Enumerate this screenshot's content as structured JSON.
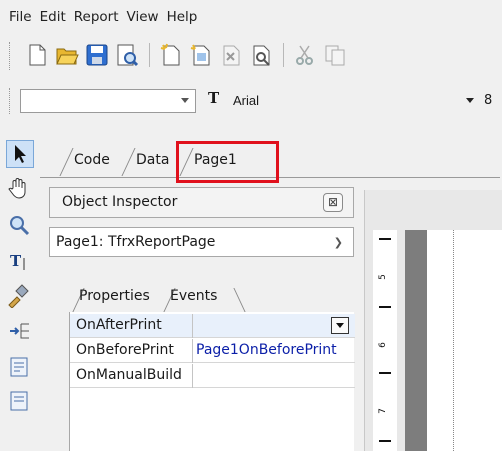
{
  "menu": [
    "File",
    "Edit",
    "Report",
    "View",
    "Help"
  ],
  "toolbar_icons": [
    "new-icon",
    "open-icon",
    "save-icon",
    "preview-icon",
    "new-page-icon",
    "new-dialog-icon",
    "delete-page-icon",
    "page-settings-icon",
    "cut-icon",
    "copy-icon"
  ],
  "format": {
    "style_value": "",
    "font_name": "Arial",
    "font_size": "8"
  },
  "tools": [
    "select-tool-icon",
    "hand-tool-icon",
    "zoom-tool-icon",
    "text-tool-icon",
    "format-copy-icon",
    "band-icon",
    "object-icon",
    "object2-icon"
  ],
  "tabs": [
    "Code",
    "Data",
    "Page1"
  ],
  "inspector": {
    "title": "Object Inspector",
    "close_glyph": "⊠",
    "object": "Page1: TfrxReportPage",
    "prop_tabs": [
      "Properties",
      "Events"
    ],
    "rows": [
      {
        "name": "OnAfterPrint",
        "value": ""
      },
      {
        "name": "OnBeforePrint",
        "value": "Page1OnBeforePrint"
      },
      {
        "name": "OnManualBuild",
        "value": ""
      }
    ]
  },
  "ruler": [
    "5",
    "6",
    "7"
  ],
  "colors": {
    "highlight": "#e0101c",
    "event_value": "#0b1fa8"
  }
}
